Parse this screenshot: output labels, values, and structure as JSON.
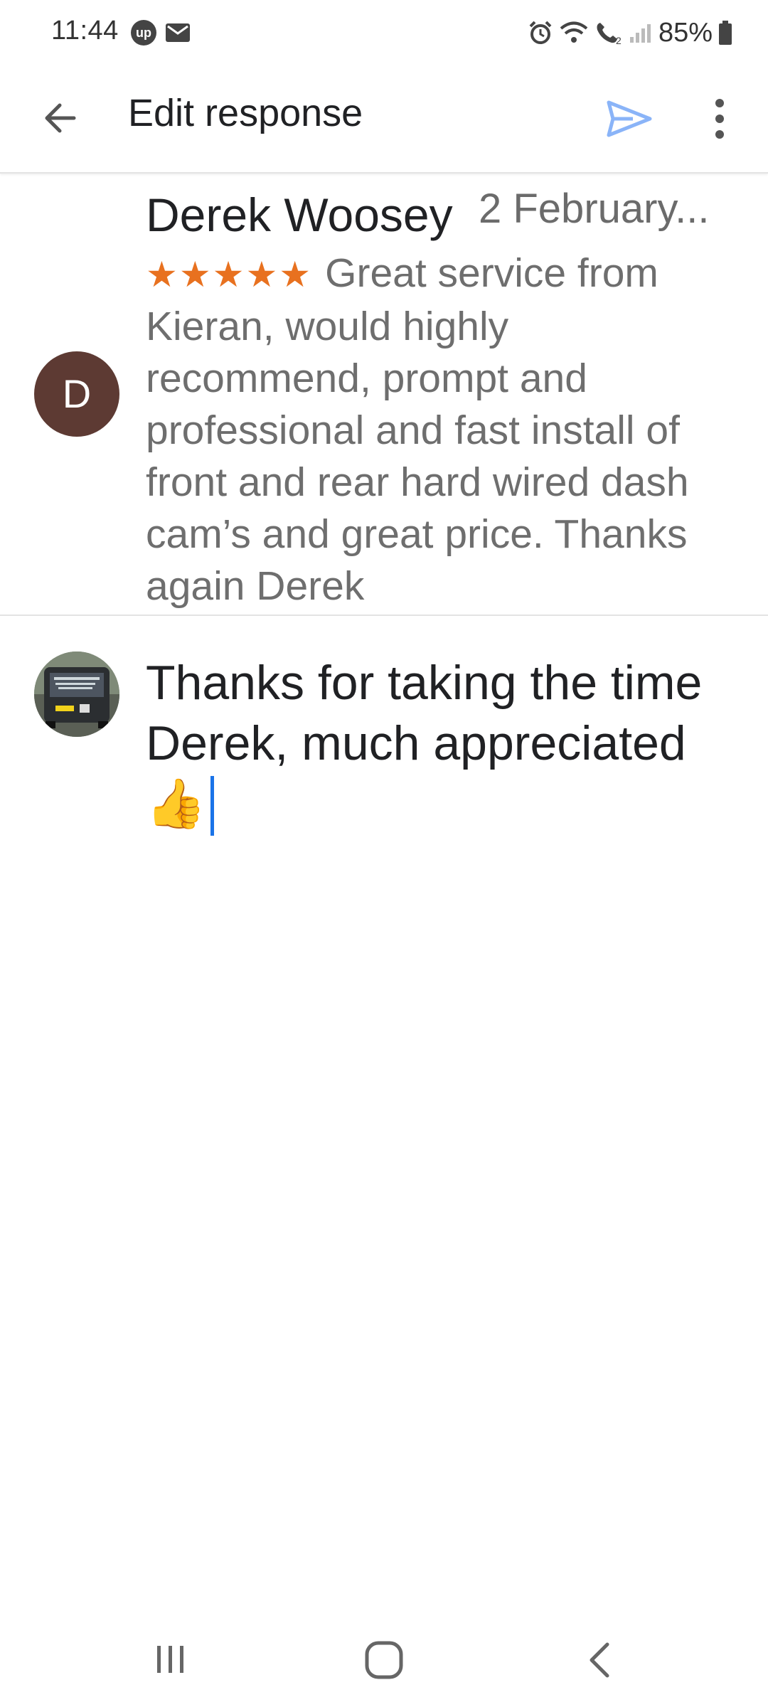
{
  "status_bar": {
    "time": "11:44",
    "up_badge": "up",
    "battery": "85%"
  },
  "app_bar": {
    "title": "Edit response"
  },
  "review": {
    "avatar_letter": "D",
    "author": "Derek Woosey",
    "date": "2 February...",
    "stars": "★★★★★",
    "rating": 5,
    "text": "Great service from Kieran, would highly recommend, prompt and professional and fast install of front and rear hard wired dash cam’s and great price. Thanks again Derek"
  },
  "reply": {
    "text": "Thanks for taking the time Derek, much appreciated 👍"
  },
  "colors": {
    "accent": "#1a73e8",
    "send_icon": "#8ab4f8",
    "star": "#e8711f",
    "avatar_bg": "#5d3a33"
  }
}
